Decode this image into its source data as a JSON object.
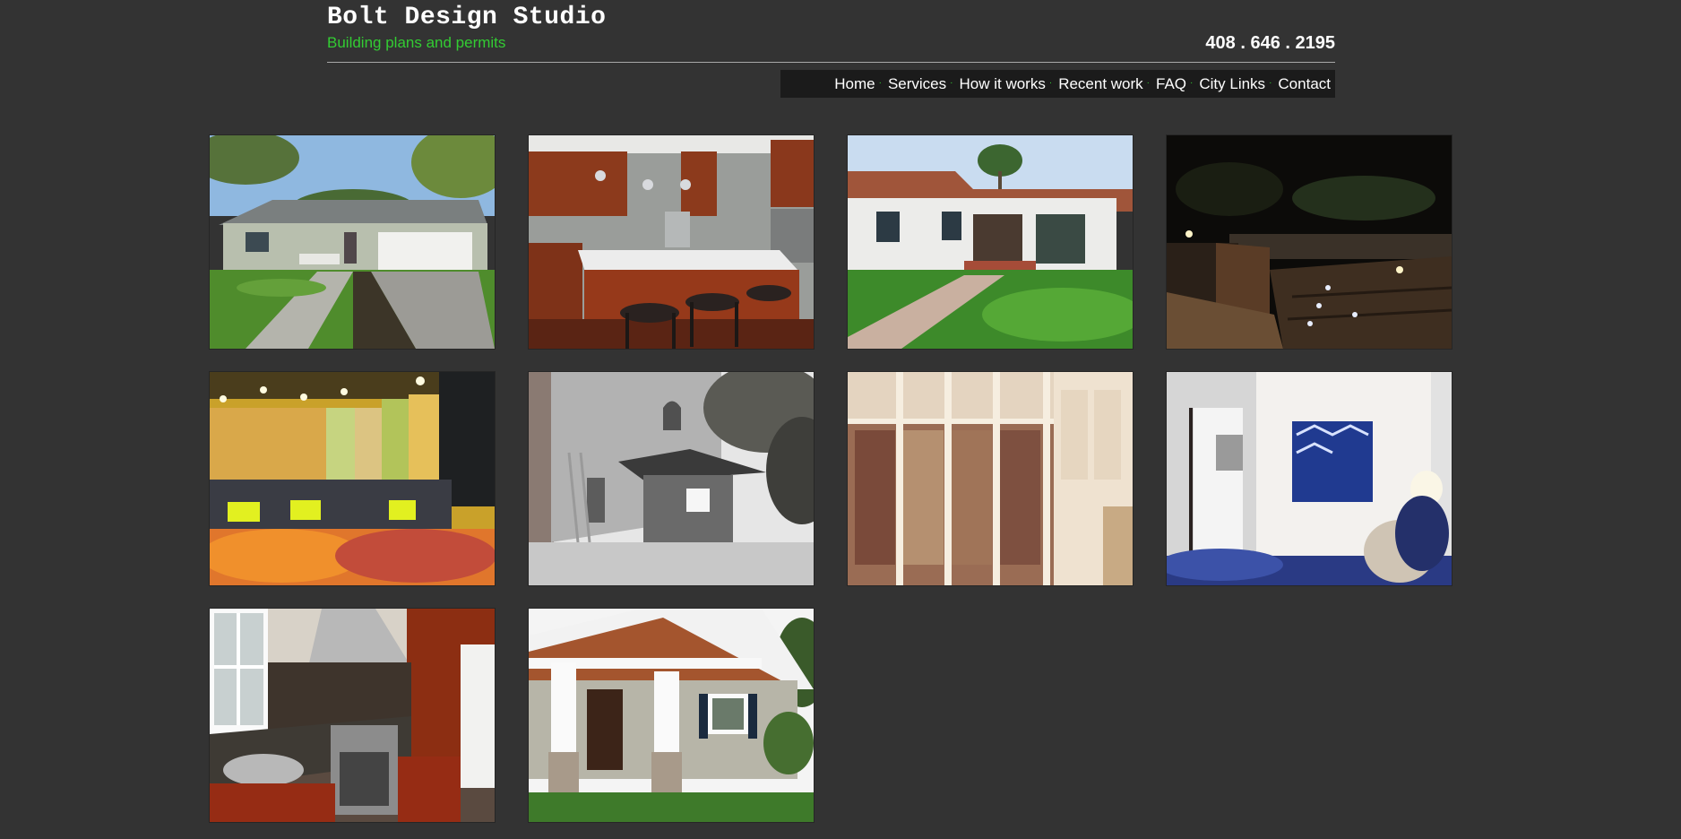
{
  "header": {
    "title": "Bolt Design Studio",
    "tagline": "Building plans and permits",
    "phone": "408 . 646 . 2195"
  },
  "nav": {
    "separator": "·",
    "items": [
      "Home",
      "Services",
      "How it works",
      "Recent work",
      "FAQ",
      "City Links",
      "Contact"
    ]
  },
  "colors": {
    "background": "#333333",
    "tagline": "#33cc33",
    "nav_background": "#1b1b1b",
    "text": "#ffffff"
  },
  "gallery": {
    "photos": [
      "ranch-house-exterior",
      "kitchen-island",
      "spanish-bungalow-exterior",
      "lit-deck-at-night",
      "grocery-produce-store",
      "stucco-accessory-unit",
      "walk-in-closet",
      "bedroom-with-artwork",
      "kitchen-stove-counter",
      "craftsman-porch-exterior"
    ]
  }
}
